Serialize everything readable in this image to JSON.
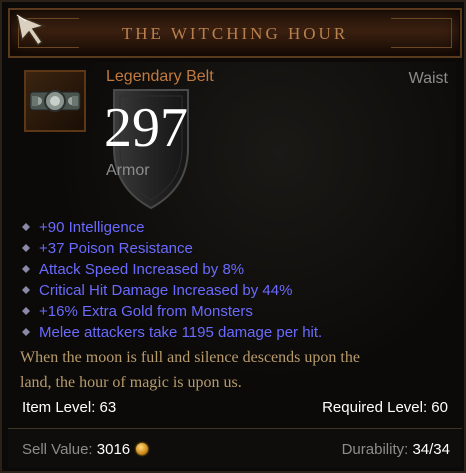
{
  "item": {
    "name": "THE WITCHING HOUR",
    "type": "Legendary Belt",
    "slot": "Waist",
    "armor_value": "297",
    "armor_label": "Armor",
    "stats": [
      {
        "text": "+90 Intelligence"
      },
      {
        "text": "+37 Poison Resistance"
      },
      {
        "text": "Attack Speed Increased by 8%"
      },
      {
        "text": "Critical Hit Damage Increased by 44%"
      },
      {
        "text": "+16% Extra Gold from Monsters"
      },
      {
        "text": "Melee attackers take 1195 damage per hit."
      }
    ],
    "flavor_line1": "When the moon is full and silence descends upon the",
    "flavor_line2": "land, the hour of magic is upon us.",
    "item_level": "Item Level: 63",
    "required_level": "Required Level: 60"
  },
  "footer": {
    "sell_label": "Sell Value:",
    "sell_value": "3016",
    "durability_label": "Durability:",
    "durability_value": "34/34"
  },
  "colors": {
    "title": "#b8804e",
    "legendary": "#c27a3e",
    "magic_stat": "#6a6aff",
    "flavor": "#b89b6c",
    "secondary_text": "#8c8c8c"
  },
  "icons": {
    "cursor": "arrow-cursor-icon",
    "item": "belt-icon",
    "armor": "shield-icon",
    "stat_bullet": "diamond-bullet-icon",
    "currency": "gold-coin-icon"
  }
}
